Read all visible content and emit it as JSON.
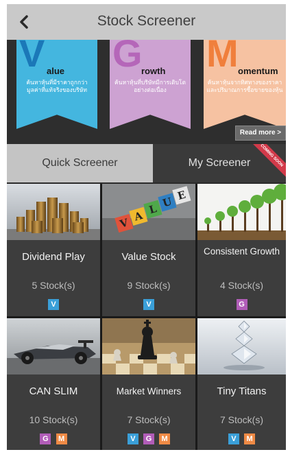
{
  "header": {
    "title": "Stock Screener"
  },
  "banner": {
    "ribbons": [
      {
        "letter": "V",
        "word": "alue",
        "desc": "ค้นหาหุ้นที่มีราคาถูกกว่ามูลค่าที่แท้จริงของบริษัท"
      },
      {
        "letter": "G",
        "word": "rowth",
        "desc": "ค้นหาหุ้นที่บริษัทมีการเติบโตอย่างต่อเนื่อง"
      },
      {
        "letter": "M",
        "word": "omentum",
        "desc": "ค้นหาหุ้นจากทิศทางของราคาและปริมาณการซื้อขายของหุ้น"
      }
    ],
    "read_more": "Read more >"
  },
  "tabs": {
    "quick": "Quick Screener",
    "my": "My Screener",
    "coming_soon": "COMING SOON"
  },
  "colors": {
    "V": "#3a9fd8",
    "G": "#b15db8",
    "M": "#ef8a45"
  },
  "screeners": [
    {
      "name": "Dividend Play",
      "count": "5 Stock(s)",
      "badges": [
        "V"
      ],
      "image": "coin-stacks"
    },
    {
      "name": "Value Stock",
      "count": "9 Stock(s)",
      "badges": [
        "V"
      ],
      "image": "value-blocks"
    },
    {
      "name": "Consistent Growth",
      "count": "4 Stock(s)",
      "badges": [
        "G"
      ],
      "image": "growing-trees"
    },
    {
      "name": "CAN SLIM",
      "count": "10 Stock(s)",
      "badges": [
        "G",
        "M"
      ],
      "image": "race-car"
    },
    {
      "name": "Market Winners",
      "count": "7 Stock(s)",
      "badges": [
        "V",
        "G",
        "M"
      ],
      "image": "chess-king"
    },
    {
      "name": "Tiny Titans",
      "count": "7 Stock(s)",
      "badges": [
        "V",
        "M"
      ],
      "image": "diamond-stack"
    }
  ]
}
